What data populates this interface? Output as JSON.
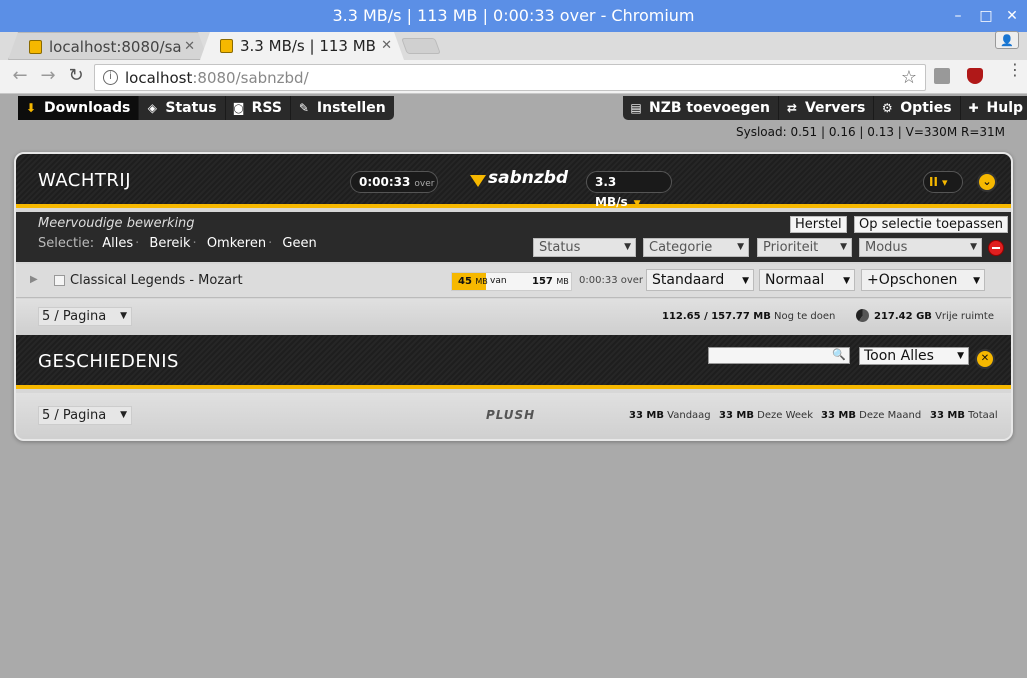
{
  "window": {
    "title": "3.3 MB/s | 113 MB | 0:00:33 over - Chromium",
    "minimize": "–",
    "maximize": "□",
    "close": "✕"
  },
  "tabs": [
    {
      "label": "localhost:8080/sa",
      "close": "✕"
    },
    {
      "label": "3.3 MB/s | 113 MB",
      "close": "✕"
    }
  ],
  "browser": {
    "back": "←",
    "forward": "→",
    "reload": "↻",
    "info": "i",
    "url_host": "localhost",
    "url_rest": ":8080/sabnzbd/",
    "star": "☆",
    "menu": "⋮",
    "profile": "👤"
  },
  "nav_left": [
    {
      "label": "Downloads",
      "icon": "download-icon",
      "glyph": "⬇"
    },
    {
      "label": "Status",
      "icon": "status-icon",
      "glyph": "◈"
    },
    {
      "label": "RSS",
      "icon": "rss-icon",
      "glyph": "◙"
    },
    {
      "label": "Instellen",
      "icon": "wrench-icon",
      "glyph": "✎"
    }
  ],
  "nav_right": [
    {
      "label": "NZB toevoegen",
      "icon": "add-nzb-icon",
      "glyph": "▤"
    },
    {
      "label": "Ververs",
      "icon": "refresh-icon",
      "glyph": "⇄"
    },
    {
      "label": "Opties",
      "icon": "gear-icon",
      "glyph": "⚙"
    },
    {
      "label": "Hulp",
      "icon": "help-icon",
      "glyph": "✚"
    }
  ],
  "sysload": "Sysload: 0.51 | 0.16 | 0.13 | V=330M R=31M",
  "queue": {
    "title": "WACHTRIJ",
    "time_left": "0:00:33",
    "time_suffix": "over",
    "logo": "sabnzbd",
    "speed": "3.3 MB/s",
    "pause": "II",
    "pause_menu": "▾",
    "collapse": "⌄",
    "bulk_label": "Meervoudige bewerking",
    "selection_label": "Selectie:",
    "selection_links": [
      "Alles",
      "Bereik",
      "Omkeren",
      "Geen"
    ],
    "reset_button": "Herstel",
    "apply_button": "Op selectie toepassen",
    "filters": [
      "Status",
      "Categorie",
      "Prioriteit",
      "Modus"
    ],
    "item": {
      "name": "Classical Legends - Mozart",
      "done": "45",
      "done_unit": "MB",
      "of": "van",
      "total": "157",
      "total_unit": "MB",
      "progress_fraction": 0.287,
      "time_left": "0:00:33 over",
      "category": "Standaard",
      "priority": "Normaal",
      "post": "+Opschonen"
    },
    "per_page": "5 / Pagina",
    "remaining": "112.65 / 157.77 MB",
    "remaining_label": "Nog te doen",
    "free_space": "217.42 GB",
    "free_label": "Vrije ruimte"
  },
  "history": {
    "title": "GESCHIEDENIS",
    "search_placeholder": "",
    "show": "Toon Alles",
    "close": "✕",
    "per_page": "5 / Pagina",
    "plush": "PLUSH",
    "today_value": "33 MB",
    "today_label": "Vandaag",
    "week_value": "33 MB",
    "week_label": "Deze Week",
    "month_value": "33 MB",
    "month_label": "Deze Maand",
    "total_value": "33 MB",
    "total_label": "Totaal"
  },
  "colors": {
    "accent": "#f6b800",
    "titlebar": "#5b8fe6",
    "header_dark": "#1e1e1e",
    "stop_red": "#e02020"
  }
}
